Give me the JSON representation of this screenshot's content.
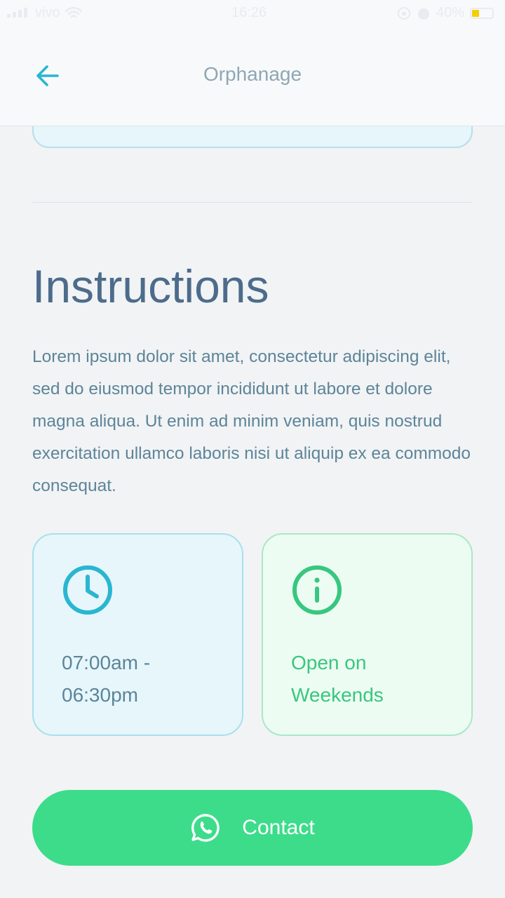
{
  "status_bar": {
    "carrier": "vivo",
    "time": "16:26",
    "battery": "40%"
  },
  "header": {
    "title": "Orphanage",
    "back_icon": "arrow-left-icon"
  },
  "instructions": {
    "title": "Instructions",
    "body": "Lorem ipsum dolor sit amet, consectetur adipiscing elit, sed do eiusmod tempor incididunt ut labore et dolore magna aliqua. Ut enim ad minim veniam, quis nostrud exercitation ullamco laboris nisi ut aliquip ex ea commodo consequat."
  },
  "cards": {
    "hours": {
      "icon": "clock-icon",
      "text": "07:00am - 06:30pm",
      "color": "#29b6d1"
    },
    "weekend": {
      "icon": "info-icon",
      "text": "Open on Weekends",
      "color": "#37c77f"
    }
  },
  "contact": {
    "label": "Contact",
    "icon": "whatsapp-icon",
    "color": "#3ddc8b"
  }
}
